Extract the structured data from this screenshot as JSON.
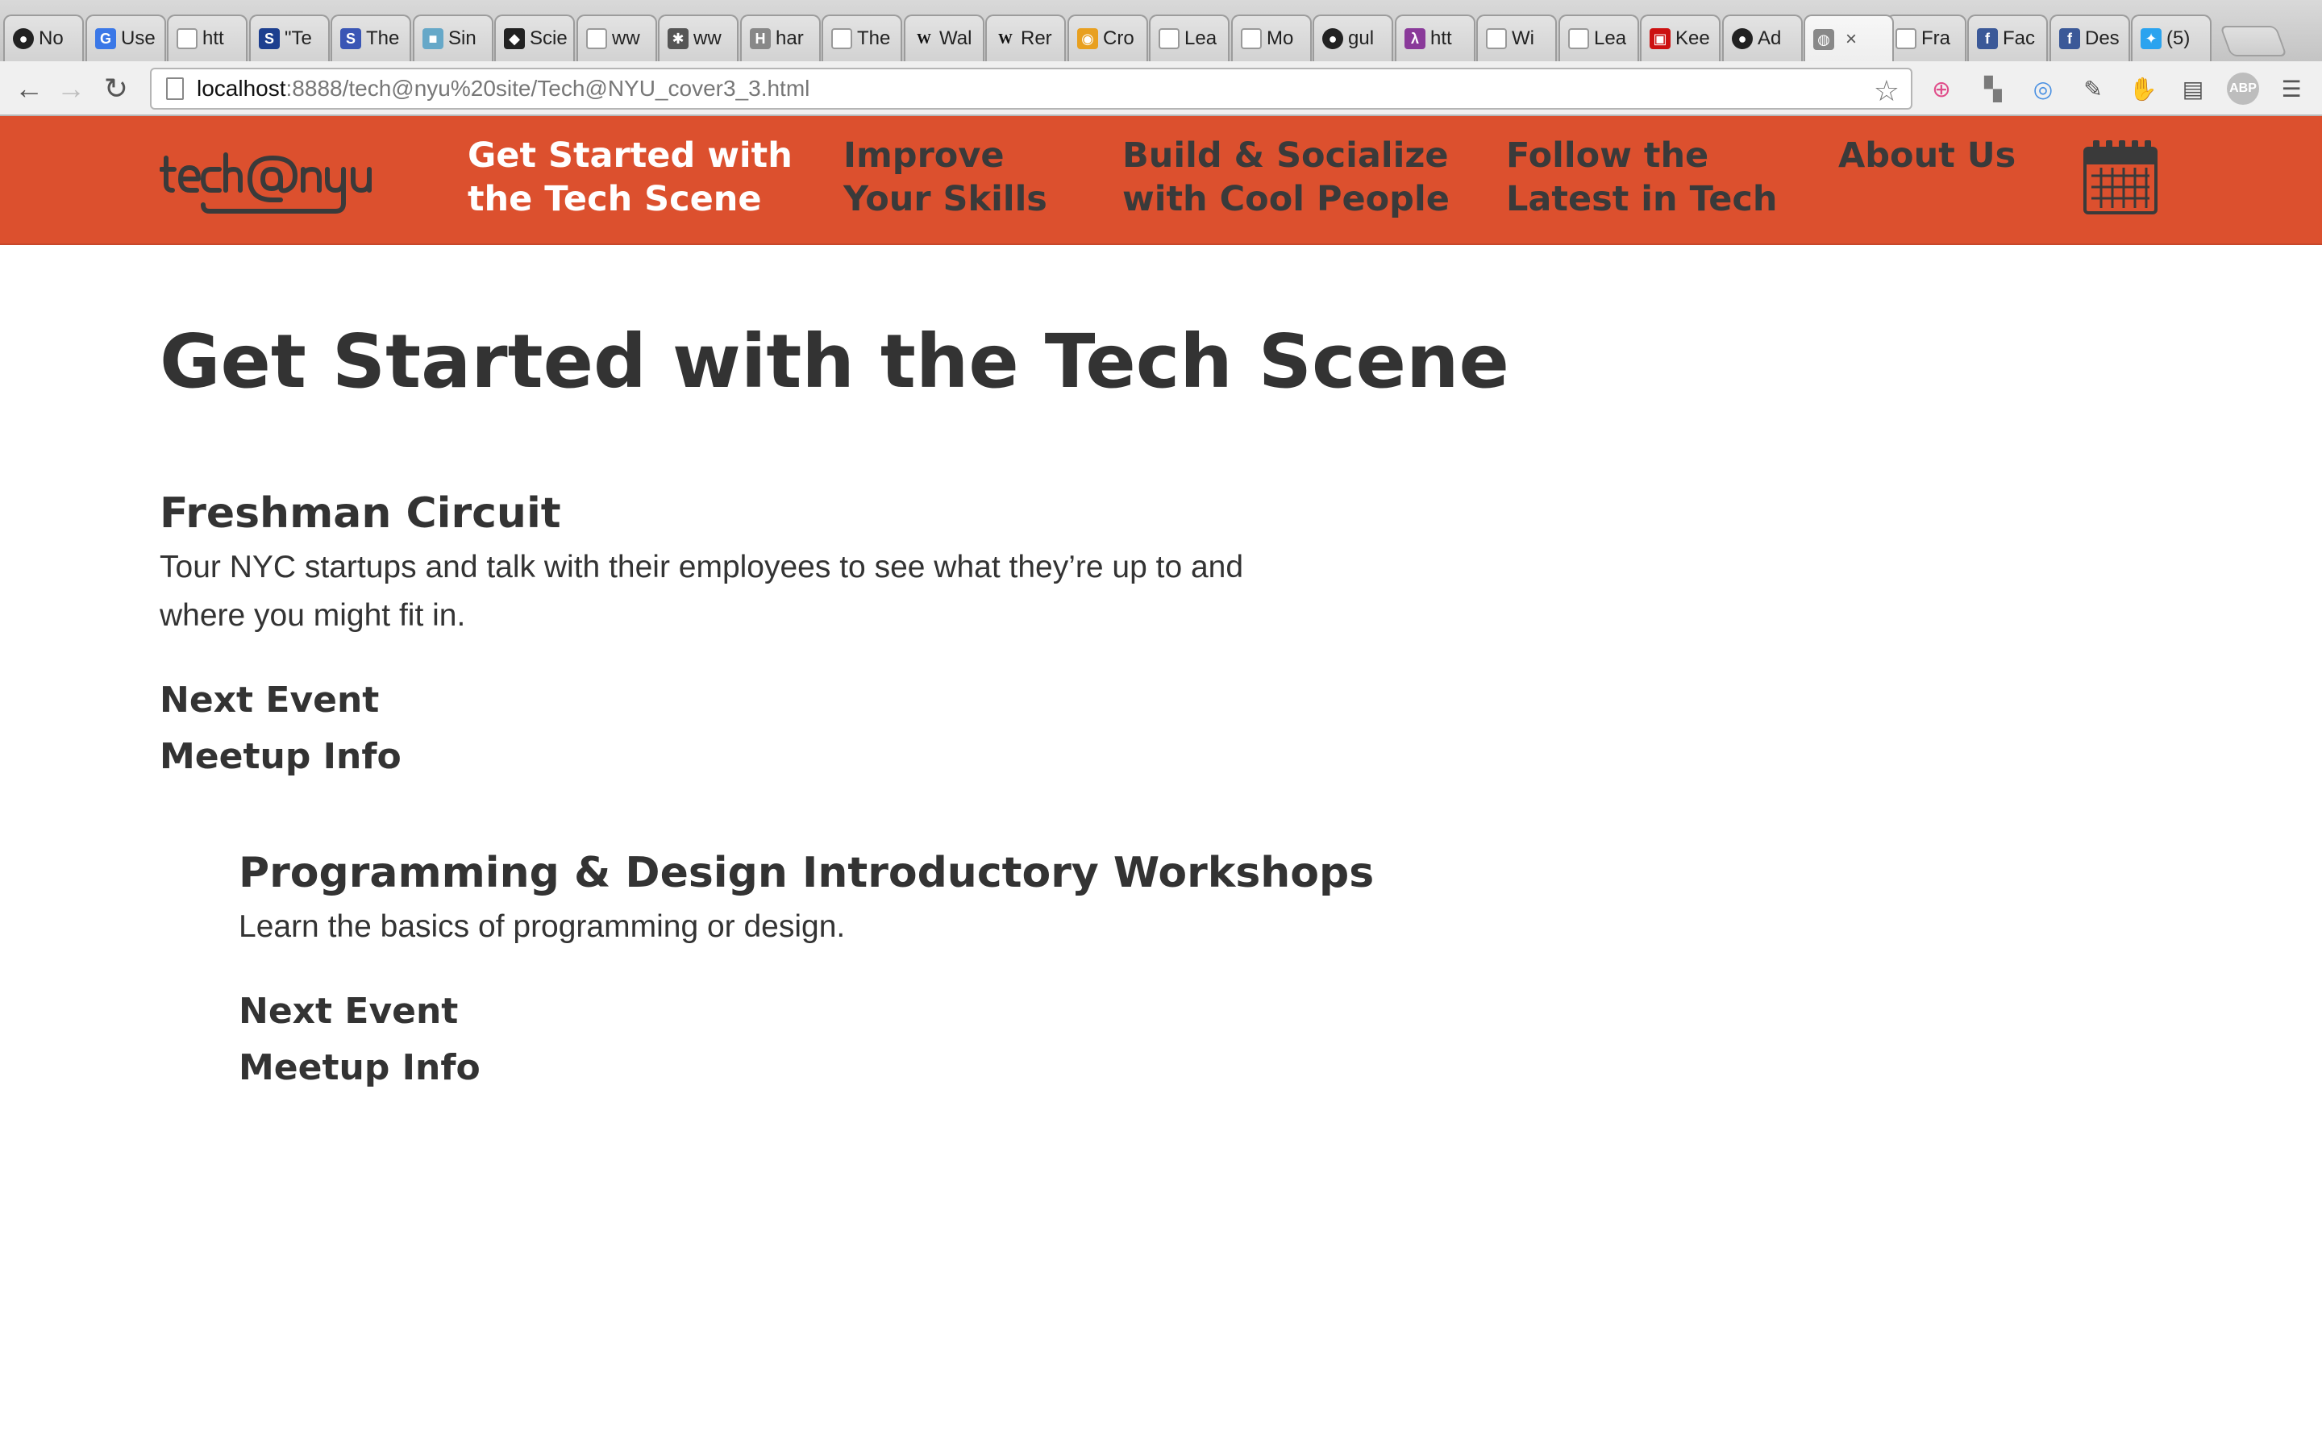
{
  "browser": {
    "tabs": [
      {
        "label": "No",
        "icon": "github-icon",
        "color": "#222222",
        "glyph": "●"
      },
      {
        "label": "Use",
        "icon": "google-icon",
        "color": "#3b78e7",
        "glyph": "G"
      },
      {
        "label": "htt",
        "icon": "page-icon",
        "color": "",
        "glyph": ""
      },
      {
        "label": "\"Te",
        "icon": "s-icon",
        "color": "#1d3f8f",
        "glyph": "S"
      },
      {
        "label": "The",
        "icon": "s-circle-icon",
        "color": "#3a56b5",
        "glyph": "S"
      },
      {
        "label": "Sin",
        "icon": "square-icon",
        "color": "#66a8c8",
        "glyph": "■"
      },
      {
        "label": "Scie",
        "icon": "science-icon",
        "color": "#222222",
        "glyph": "◆"
      },
      {
        "label": "ww",
        "icon": "page-icon",
        "color": "",
        "glyph": ""
      },
      {
        "label": "ww",
        "icon": "hedgehog-icon",
        "color": "#555555",
        "glyph": "✱"
      },
      {
        "label": "har",
        "icon": "hi-icon",
        "color": "#888888",
        "glyph": "H"
      },
      {
        "label": "The",
        "icon": "page-icon",
        "color": "",
        "glyph": ""
      },
      {
        "label": "Wal",
        "icon": "wikipedia-icon",
        "color": "",
        "glyph": "W"
      },
      {
        "label": "Rer",
        "icon": "wikipedia-icon",
        "color": "",
        "glyph": "W"
      },
      {
        "label": "Cro",
        "icon": "chrome-icon",
        "color": "#e8a020",
        "glyph": "◉"
      },
      {
        "label": "Lea",
        "icon": "page-icon",
        "color": "",
        "glyph": ""
      },
      {
        "label": "Mo",
        "icon": "page-icon",
        "color": "",
        "glyph": ""
      },
      {
        "label": "gul",
        "icon": "github-icon",
        "color": "#222222",
        "glyph": "●"
      },
      {
        "label": "htt",
        "icon": "lambda-icon",
        "color": "#8a3a9a",
        "glyph": "λ"
      },
      {
        "label": "Wi",
        "icon": "page-icon",
        "color": "",
        "glyph": ""
      },
      {
        "label": "Lea",
        "icon": "page-icon",
        "color": "",
        "glyph": ""
      },
      {
        "label": "Kee",
        "icon": "grid-icon",
        "color": "#cc1111",
        "glyph": "▣"
      },
      {
        "label": "Ad",
        "icon": "github-icon",
        "color": "#222222",
        "glyph": "●"
      },
      {
        "label": "",
        "icon": "globe-icon",
        "color": "#888888",
        "glyph": "◍",
        "active": true,
        "close": "×"
      },
      {
        "label": "Fra",
        "icon": "page-icon",
        "color": "",
        "glyph": ""
      },
      {
        "label": "Fac",
        "icon": "facebook-icon",
        "color": "#3b5998",
        "glyph": "f"
      },
      {
        "label": "Des",
        "icon": "facebook-icon",
        "color": "#3b5998",
        "glyph": "f"
      },
      {
        "label": "(5)",
        "icon": "twitter-icon",
        "color": "#2aa3ef",
        "glyph": "✦"
      }
    ],
    "url_host": "localhost",
    "url_path": ":8888/tech@nyu%20site/Tech@NYU_cover3_3.html",
    "back_glyph": "←",
    "forward_glyph": "→",
    "reload_glyph": "↻",
    "star_glyph": "☆",
    "extensions": [
      {
        "name": "plus-extension-icon",
        "glyph": "⊕",
        "color": "#e04d8a"
      },
      {
        "name": "chart-extension-icon",
        "glyph": "▚",
        "color": "#7a7a7a"
      },
      {
        "name": "target-extension-icon",
        "glyph": "◎",
        "color": "#4a90e2"
      },
      {
        "name": "wrench-icon",
        "glyph": "✎",
        "color": "#555555"
      },
      {
        "name": "hand-extension-icon",
        "glyph": "✋",
        "color": "#e04d8a"
      },
      {
        "name": "document-extension-icon",
        "glyph": "▤",
        "color": "#555555"
      },
      {
        "name": "adblock-icon",
        "glyph": "ABP",
        "color": "#9a9a9a"
      },
      {
        "name": "menu-icon",
        "glyph": "☰",
        "color": "#555555"
      }
    ]
  },
  "site": {
    "brand_color": "#dc502e",
    "logo_text": "tech@nyu",
    "nav": [
      {
        "label": "Get Started with\nthe Tech Scene",
        "active": true
      },
      {
        "label": "Improve\nYour Skills",
        "active": false
      },
      {
        "label": "Build & Socialize\nwith Cool People",
        "active": false
      },
      {
        "label": "Follow the\nLatest in Tech",
        "active": false
      },
      {
        "label": "About Us",
        "active": false
      }
    ],
    "calendar_icon": "calendar-icon"
  },
  "page": {
    "title": "Get Started with the Tech Scene",
    "sections": [
      {
        "heading": "Freshman Circuit",
        "description": "Tour NYC startups and talk with their employees to see what they’re up to and where you might fit in.",
        "links": [
          "Next Event",
          "Meetup Info"
        ]
      },
      {
        "heading": "Programming & Design Introductory Workshops",
        "description": "Learn the basics of programming or design.",
        "links": [
          "Next Event",
          "Meetup Info"
        ]
      }
    ]
  }
}
